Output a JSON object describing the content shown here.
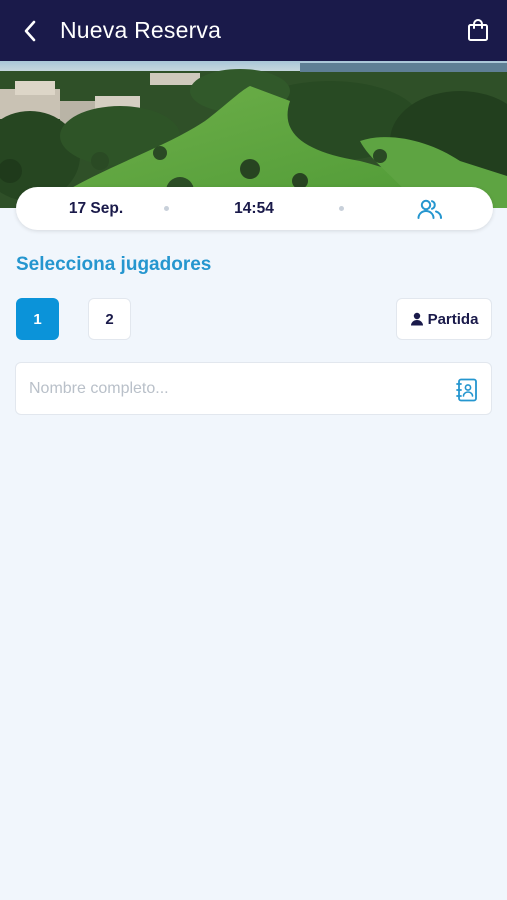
{
  "header": {
    "title": "Nueva Reserva",
    "back_icon": "chevron-left-icon",
    "bag_icon": "shopping-bag-icon"
  },
  "hero": {
    "image": "golf-course-aerial"
  },
  "booking": {
    "date": "17 Sep.",
    "time": "14:54",
    "players_icon": "users-icon"
  },
  "players": {
    "title": "Selecciona jugadores",
    "options": [
      "1",
      "2"
    ],
    "selected": "1",
    "partida_label": "Partida",
    "partida_icon": "user-icon"
  },
  "name_input": {
    "placeholder": "Nombre completo...",
    "value": "",
    "icon": "contacts-book-icon"
  },
  "colors": {
    "header_bg": "#1a1a4a",
    "accent": "#0b93d9",
    "title_accent": "#2596cf",
    "page_bg": "#f1f6fc"
  }
}
